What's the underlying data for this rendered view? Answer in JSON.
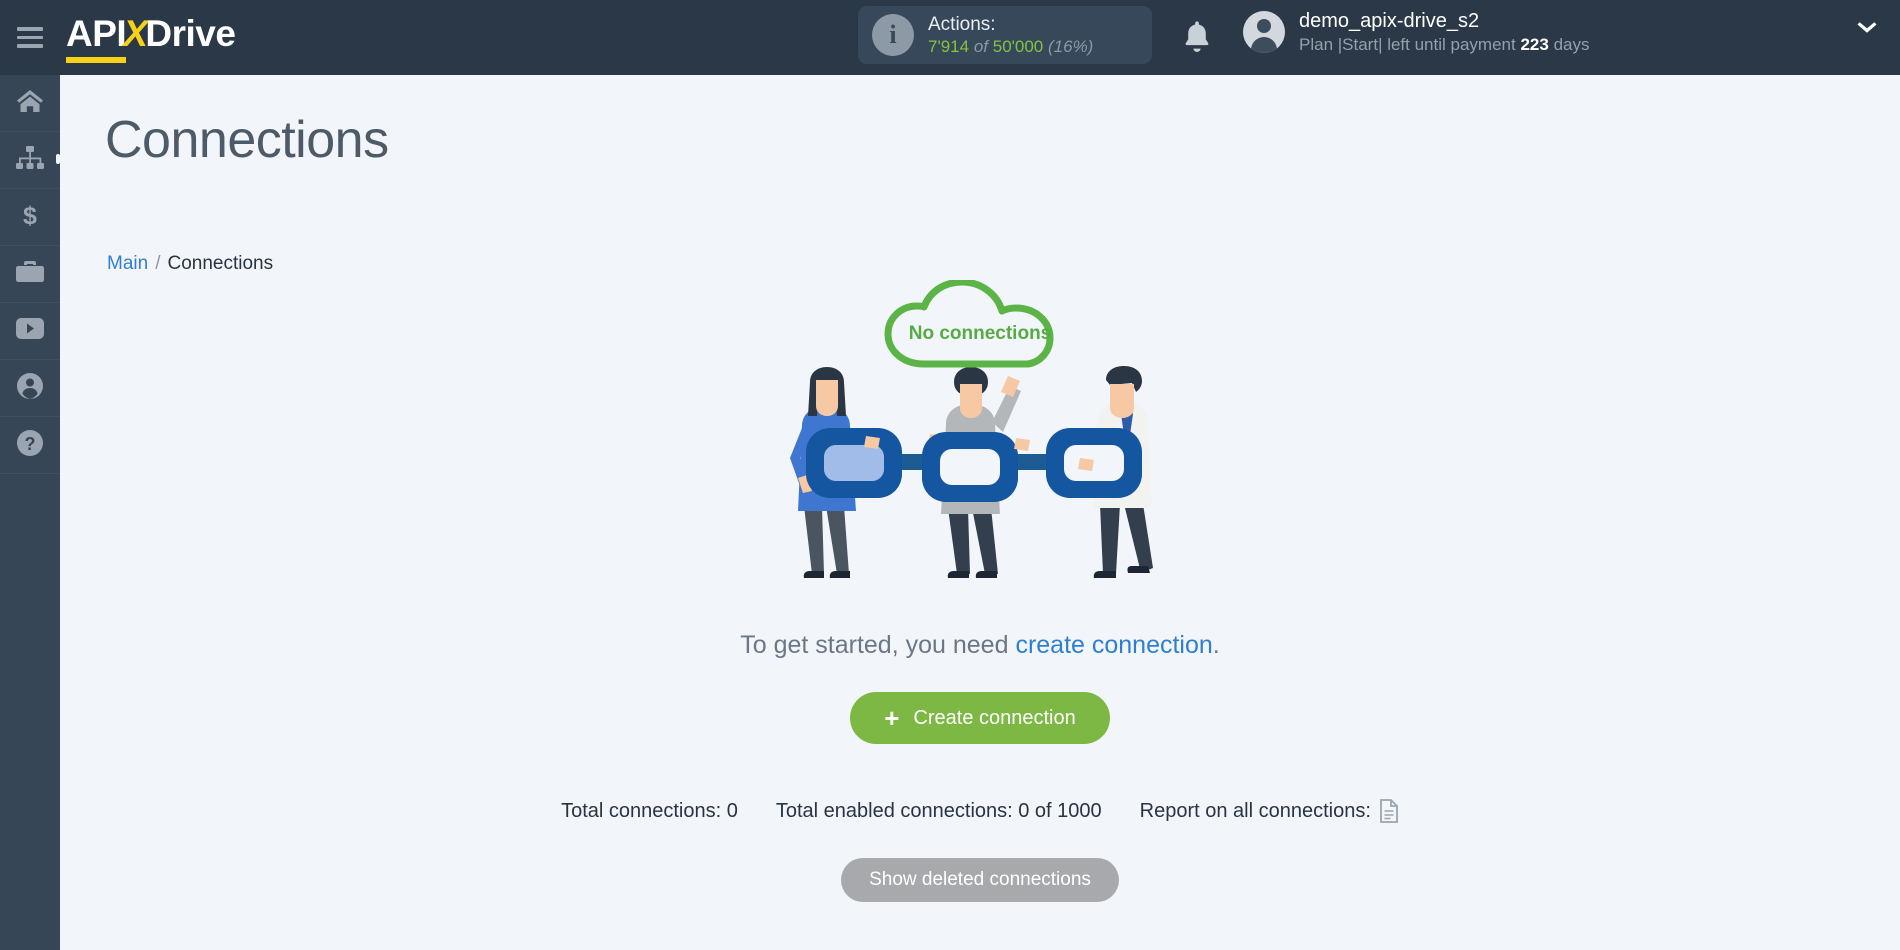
{
  "header": {
    "menu_icon": "hamburger-menu-icon",
    "logo": {
      "part1": "API",
      "part2": "X",
      "part3": "Drive"
    },
    "actions": {
      "icon": "info-icon",
      "title": "Actions:",
      "used": "7'914",
      "of": "of",
      "total": "50'000",
      "percent": "(16%)"
    },
    "notifications_icon": "bell-icon",
    "user": {
      "avatar_icon": "user-avatar-icon",
      "name": "demo_apix-drive_s2",
      "plan_prefix": "Plan |Start| left until payment",
      "days_value": "223",
      "days_label": "days"
    },
    "dropdown_icon": "chevron-down-icon"
  },
  "sidebar": {
    "items": [
      {
        "name": "home",
        "icon": "home-icon"
      },
      {
        "name": "connections",
        "icon": "sitemap-icon",
        "active": true
      },
      {
        "name": "payments",
        "icon": "dollar-icon"
      },
      {
        "name": "services",
        "icon": "briefcase-icon"
      },
      {
        "name": "videos",
        "icon": "youtube-icon"
      },
      {
        "name": "account",
        "icon": "user-circle-icon"
      },
      {
        "name": "help",
        "icon": "question-circle-icon"
      }
    ]
  },
  "main": {
    "page_title": "Connections",
    "breadcrumb": {
      "root": "Main",
      "separator": "/",
      "current": "Connections"
    },
    "empty_state": {
      "cloud_label": "No connections",
      "illustration": "three-people-holding-chain-links",
      "hint_prefix": "To get started, you need",
      "hint_link": "create connection",
      "hint_suffix": "."
    },
    "create_button": {
      "icon": "plus-icon",
      "label": "Create connection"
    },
    "stats": {
      "total_connections": "Total connections: 0",
      "total_enabled": "Total enabled connections: 0 of 1000",
      "report_label": "Report on all connections:",
      "report_icon": "document-icon"
    },
    "show_deleted_button": "Show deleted connections"
  },
  "colors": {
    "header_bg": "#2b3847",
    "sidebar_bg": "#374656",
    "content_bg": "#f2f6fb",
    "accent_green": "#7cb843",
    "cloud_green": "#57ab42",
    "link_blue": "#2f7fd0",
    "logo_yellow": "#f7d117",
    "chain_blue": "#1456a0",
    "gray_button": "#a7a9ac"
  }
}
